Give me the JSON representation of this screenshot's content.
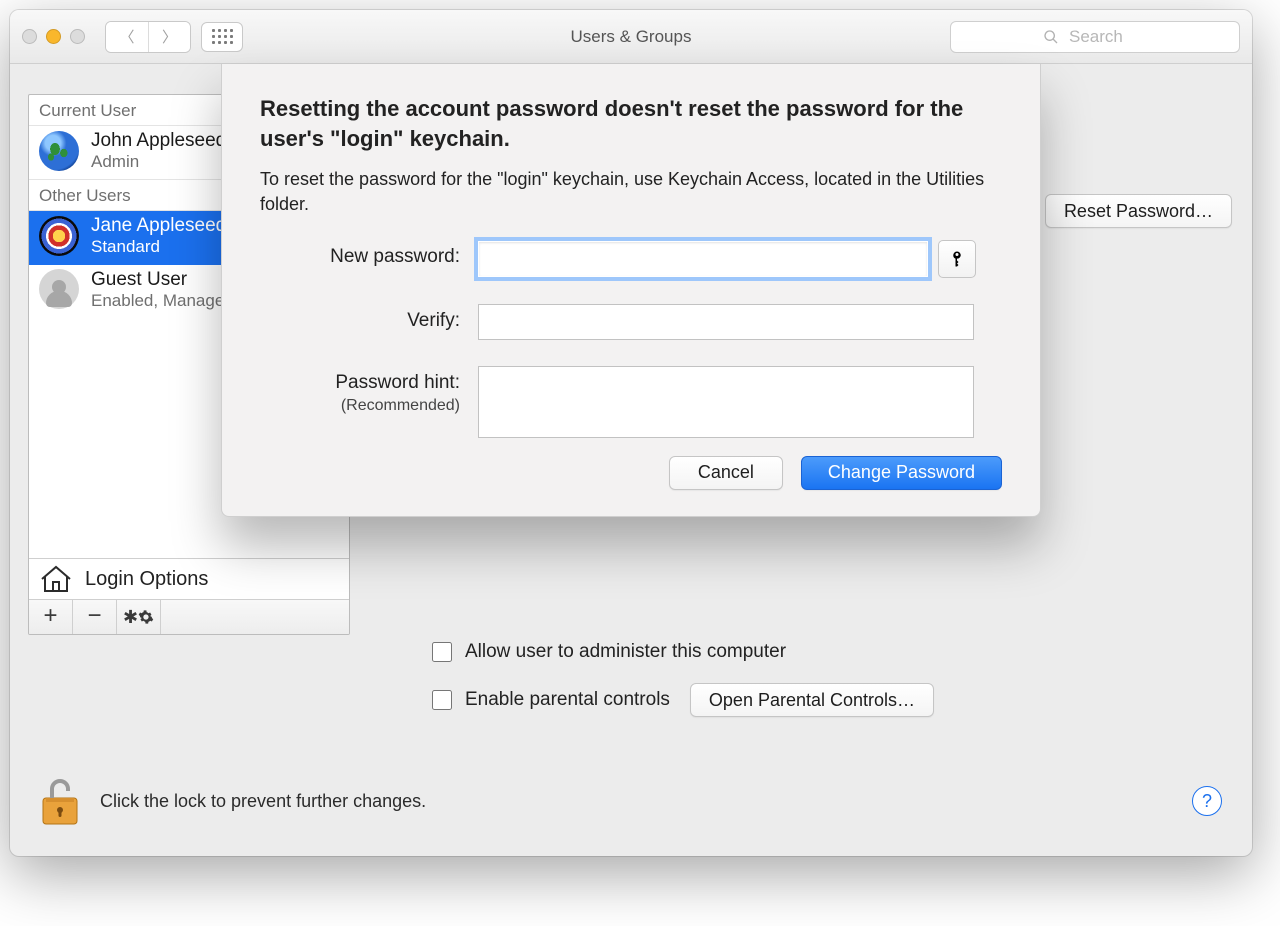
{
  "window": {
    "title": "Users & Groups",
    "search_placeholder": "Search"
  },
  "sidebar": {
    "current_user_header": "Current User",
    "other_users_header": "Other Users",
    "users": [
      {
        "name": "John Appleseed",
        "role": "Admin",
        "avatar": "earth",
        "selected": false
      },
      {
        "name": "Jane Appleseed",
        "role": "Standard",
        "avatar": "target",
        "selected": true
      },
      {
        "name": "Guest User",
        "role": "Enabled, Managed",
        "avatar": "blank",
        "selected": false
      }
    ],
    "login_options_label": "Login Options"
  },
  "main": {
    "reset_password_button": "Reset Password…",
    "allow_admin_label": "Allow user to administer this computer",
    "parental_label": "Enable parental controls",
    "open_parental_button": "Open Parental Controls…"
  },
  "lock": {
    "message": "Click the lock to prevent further changes."
  },
  "sheet": {
    "heading": "Resetting the account password doesn't reset the password for the user's \"login\" keychain.",
    "body": "To reset the password for the \"login\" keychain, use Keychain Access, located in the Utilities folder.",
    "new_password_label": "New password:",
    "verify_label": "Verify:",
    "hint_label": "Password hint:",
    "hint_sub": "(Recommended)",
    "cancel": "Cancel",
    "change": "Change Password"
  }
}
